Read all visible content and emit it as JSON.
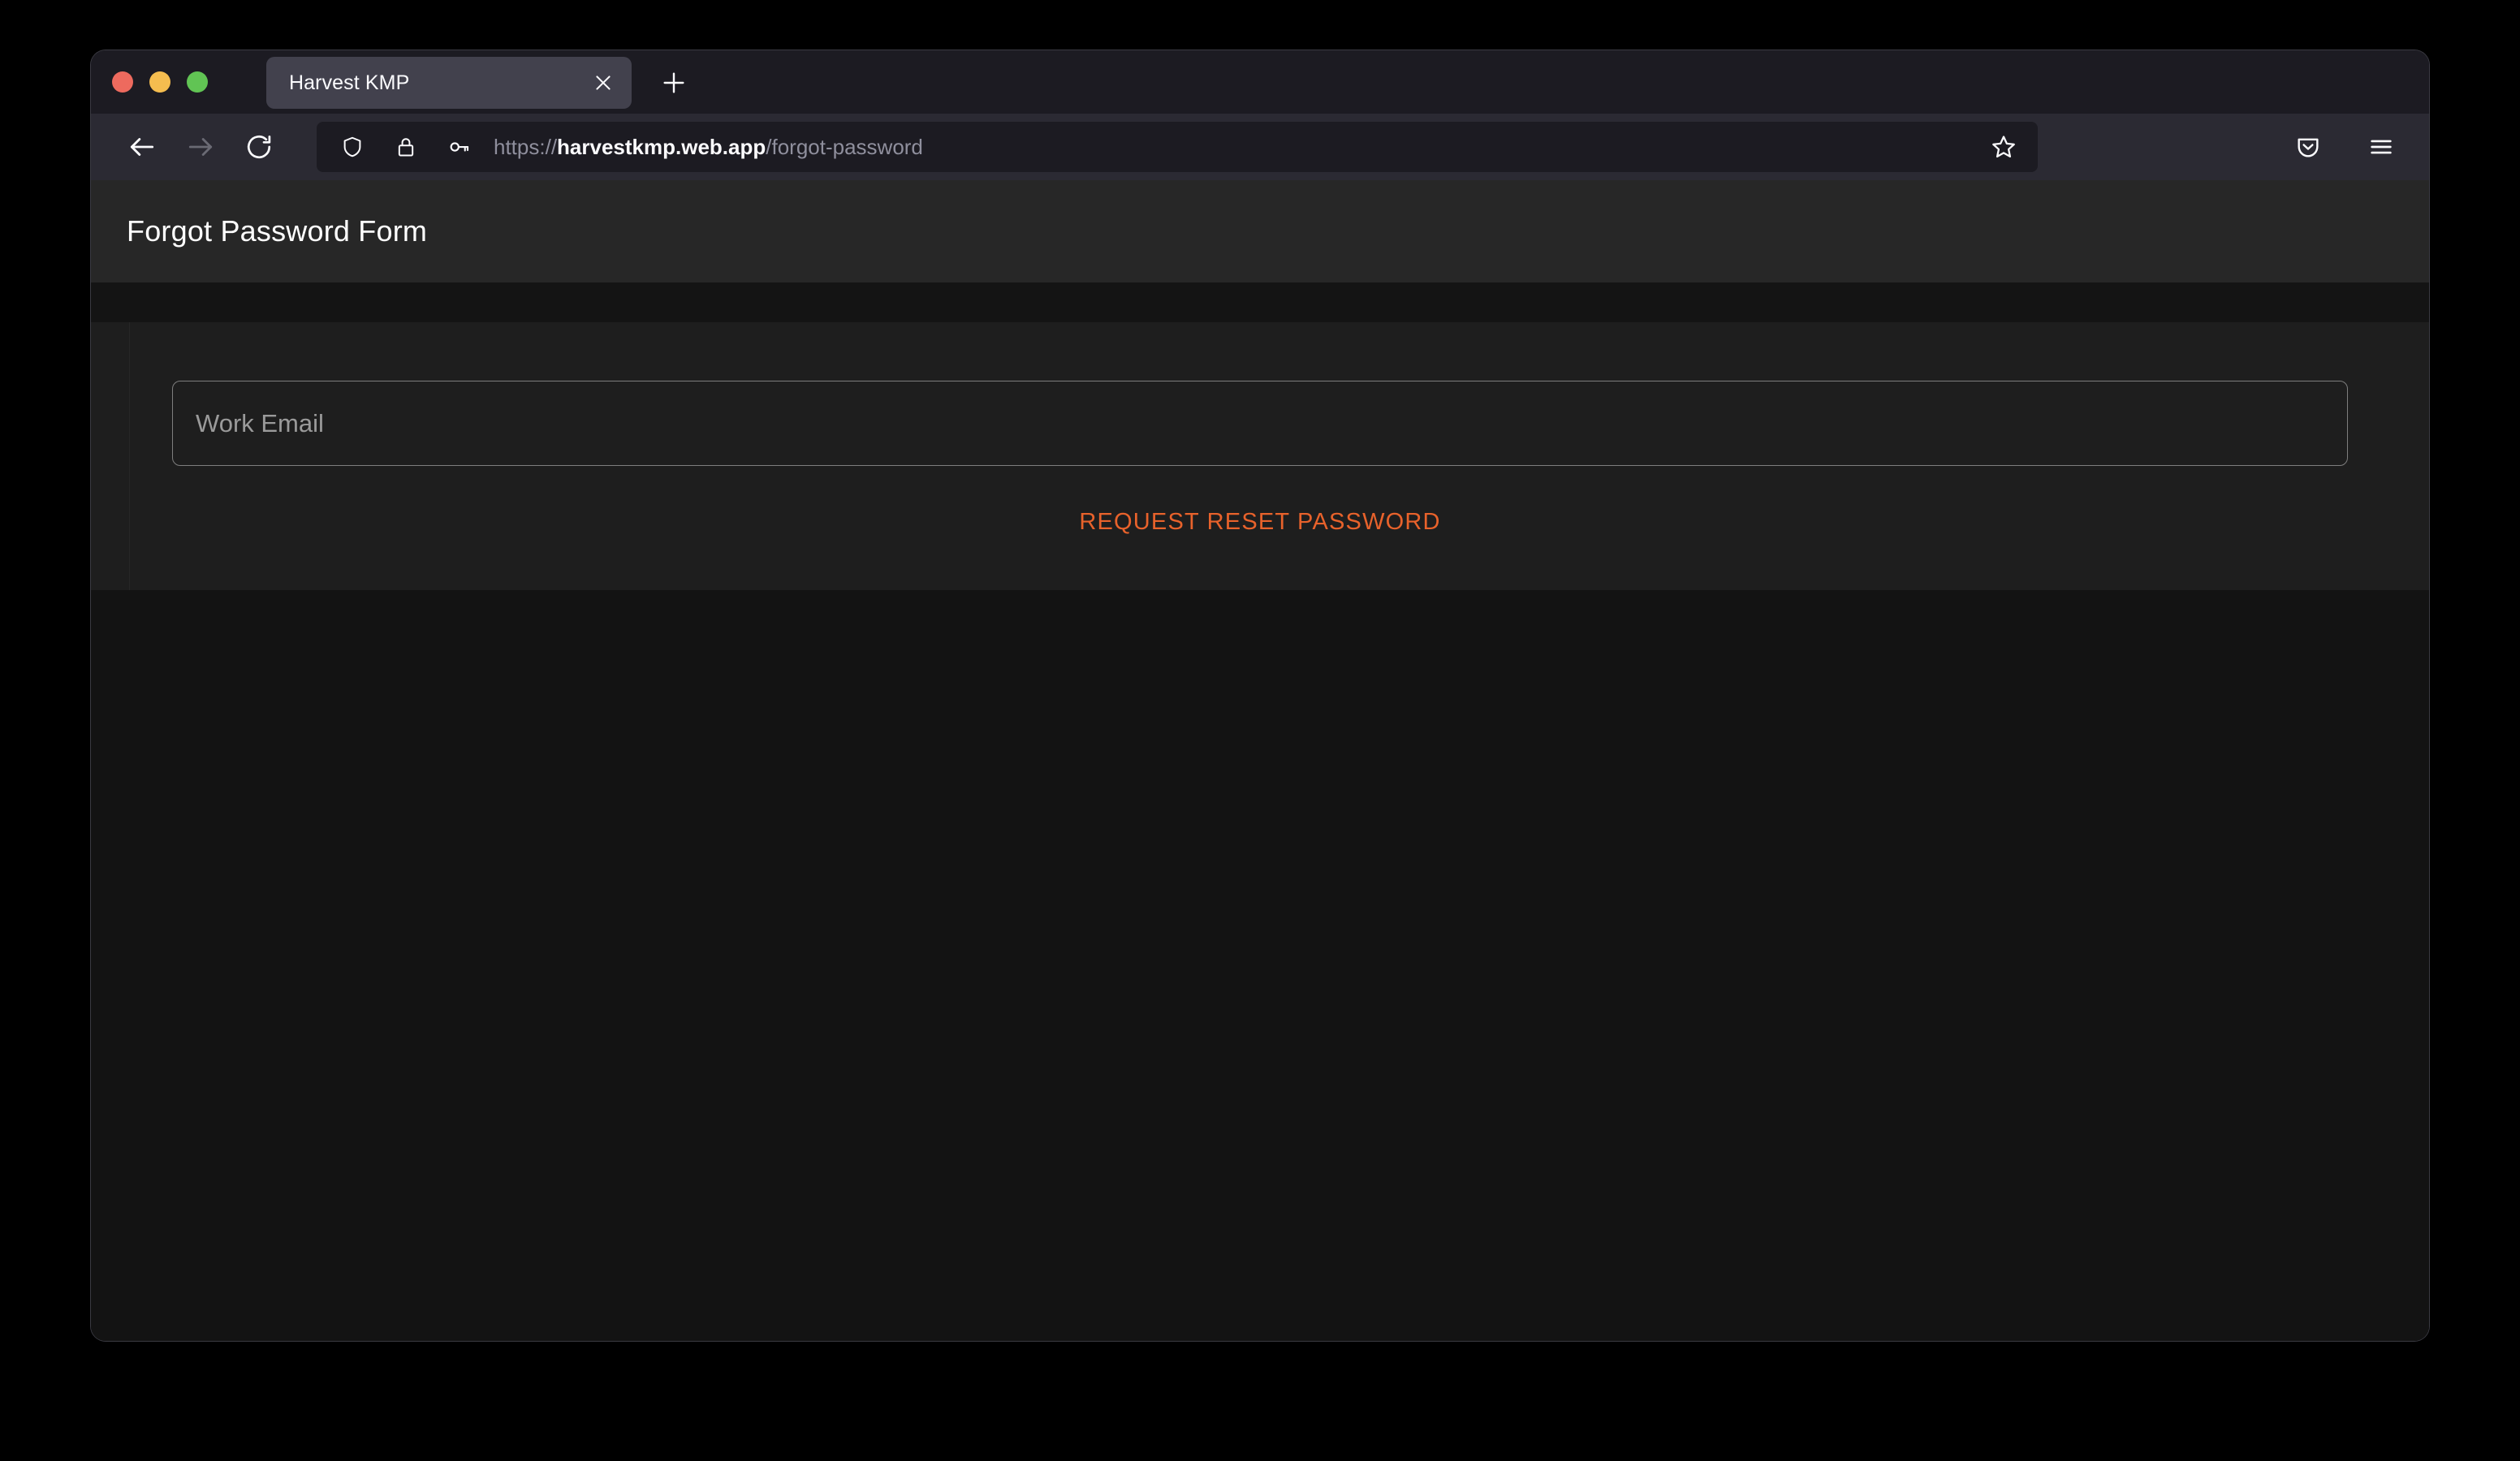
{
  "window": {
    "traffic_lights": [
      {
        "name": "close",
        "color": "#ED6A5E"
      },
      {
        "name": "minimize",
        "color": "#F5BD4F"
      },
      {
        "name": "zoom",
        "color": "#61C454"
      }
    ]
  },
  "tabs": {
    "items": [
      {
        "title": "Harvest KMP",
        "active": true,
        "close_icon": "close-icon"
      }
    ],
    "new_tab_icon": "plus-icon"
  },
  "toolbar": {
    "back_icon": "back-arrow-icon",
    "forward_icon": "forward-arrow-icon",
    "reload_icon": "reload-icon",
    "shield_icon": "shield-icon",
    "lock_icon": "lock-icon",
    "key_icon": "key-icon",
    "bookmark_icon": "star-icon",
    "pocket_icon": "pocket-icon",
    "menu_icon": "hamburger-menu-icon"
  },
  "url": {
    "scheme": "https://",
    "domain": "harvestkmp.web.app",
    "path": "/forgot-password",
    "full": "https://harvestkmp.web.app/forgot-password"
  },
  "page": {
    "app_bar_title": "Forgot Password Form",
    "form": {
      "email_placeholder": "Work Email",
      "email_value": "",
      "submit_label": "REQUEST RESET PASSWORD"
    }
  },
  "colors": {
    "accent": "#E8622B",
    "app_bar_bg": "#272727",
    "panel_bg": "#1e1e1e",
    "page_bg": "#131313",
    "toolbar_bg": "#2b2a33",
    "tabstrip_bg": "#1c1b22",
    "active_tab_bg": "#42414d"
  }
}
